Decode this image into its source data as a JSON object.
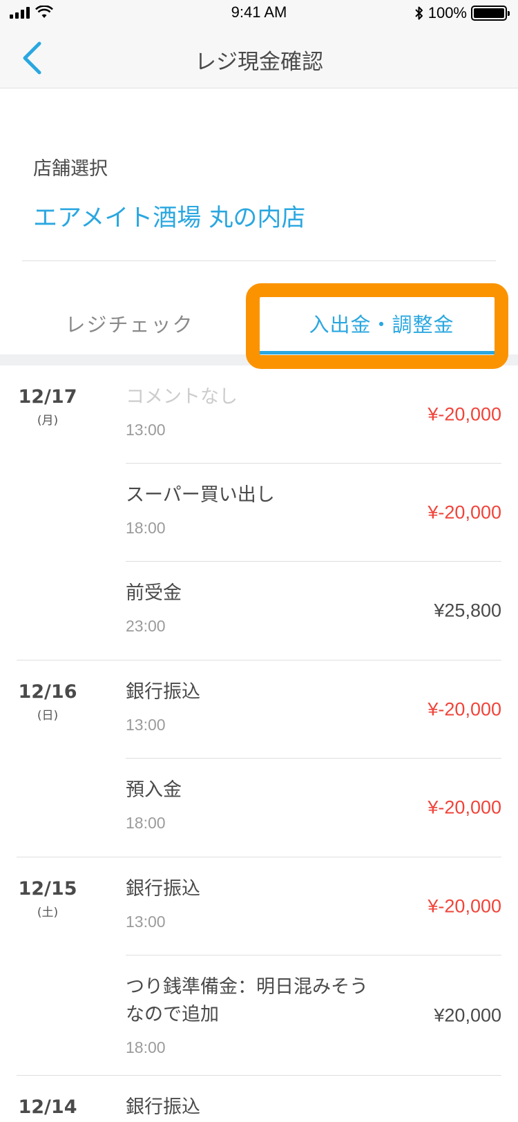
{
  "status_bar": {
    "time": "9:41 AM",
    "battery_text": "100%"
  },
  "nav": {
    "title": "レジ現金確認"
  },
  "store": {
    "label": "店舗選択",
    "name": "エアメイト酒場 丸の内店"
  },
  "tabs": [
    {
      "label": "レジチェック",
      "active": false
    },
    {
      "label": "入出金・調整金",
      "active": true
    }
  ],
  "colors": {
    "accent": "#2aa7e0",
    "negative": "#f0443a",
    "highlight": "#fb9300"
  },
  "groups": [
    {
      "date": "12/17",
      "day": "(月)",
      "entries": [
        {
          "title": "コメントなし",
          "time": "13:00",
          "amount": "¥-20,000",
          "negative": true,
          "muted": true
        },
        {
          "title": "スーパー買い出し",
          "time": "18:00",
          "amount": "¥-20,000",
          "negative": true
        },
        {
          "title": "前受金",
          "time": "23:00",
          "amount": "¥25,800",
          "negative": false
        }
      ]
    },
    {
      "date": "12/16",
      "day": "(日)",
      "entries": [
        {
          "title": "銀行振込",
          "time": "13:00",
          "amount": "¥-20,000",
          "negative": true
        },
        {
          "title": "預入金",
          "time": "18:00",
          "amount": "¥-20,000",
          "negative": true
        }
      ]
    },
    {
      "date": "12/15",
      "day": "(土)",
      "entries": [
        {
          "title": "銀行振込",
          "time": "13:00",
          "amount": "¥-20,000",
          "negative": true
        },
        {
          "title": "つり銭準備金：明日混みそうなので追加",
          "time": "18:00",
          "amount": "¥20,000",
          "negative": false
        }
      ]
    },
    {
      "date": "12/14",
      "day": "",
      "entries": [
        {
          "title": "銀行振込",
          "time": "",
          "amount": "",
          "negative": true
        }
      ]
    }
  ]
}
